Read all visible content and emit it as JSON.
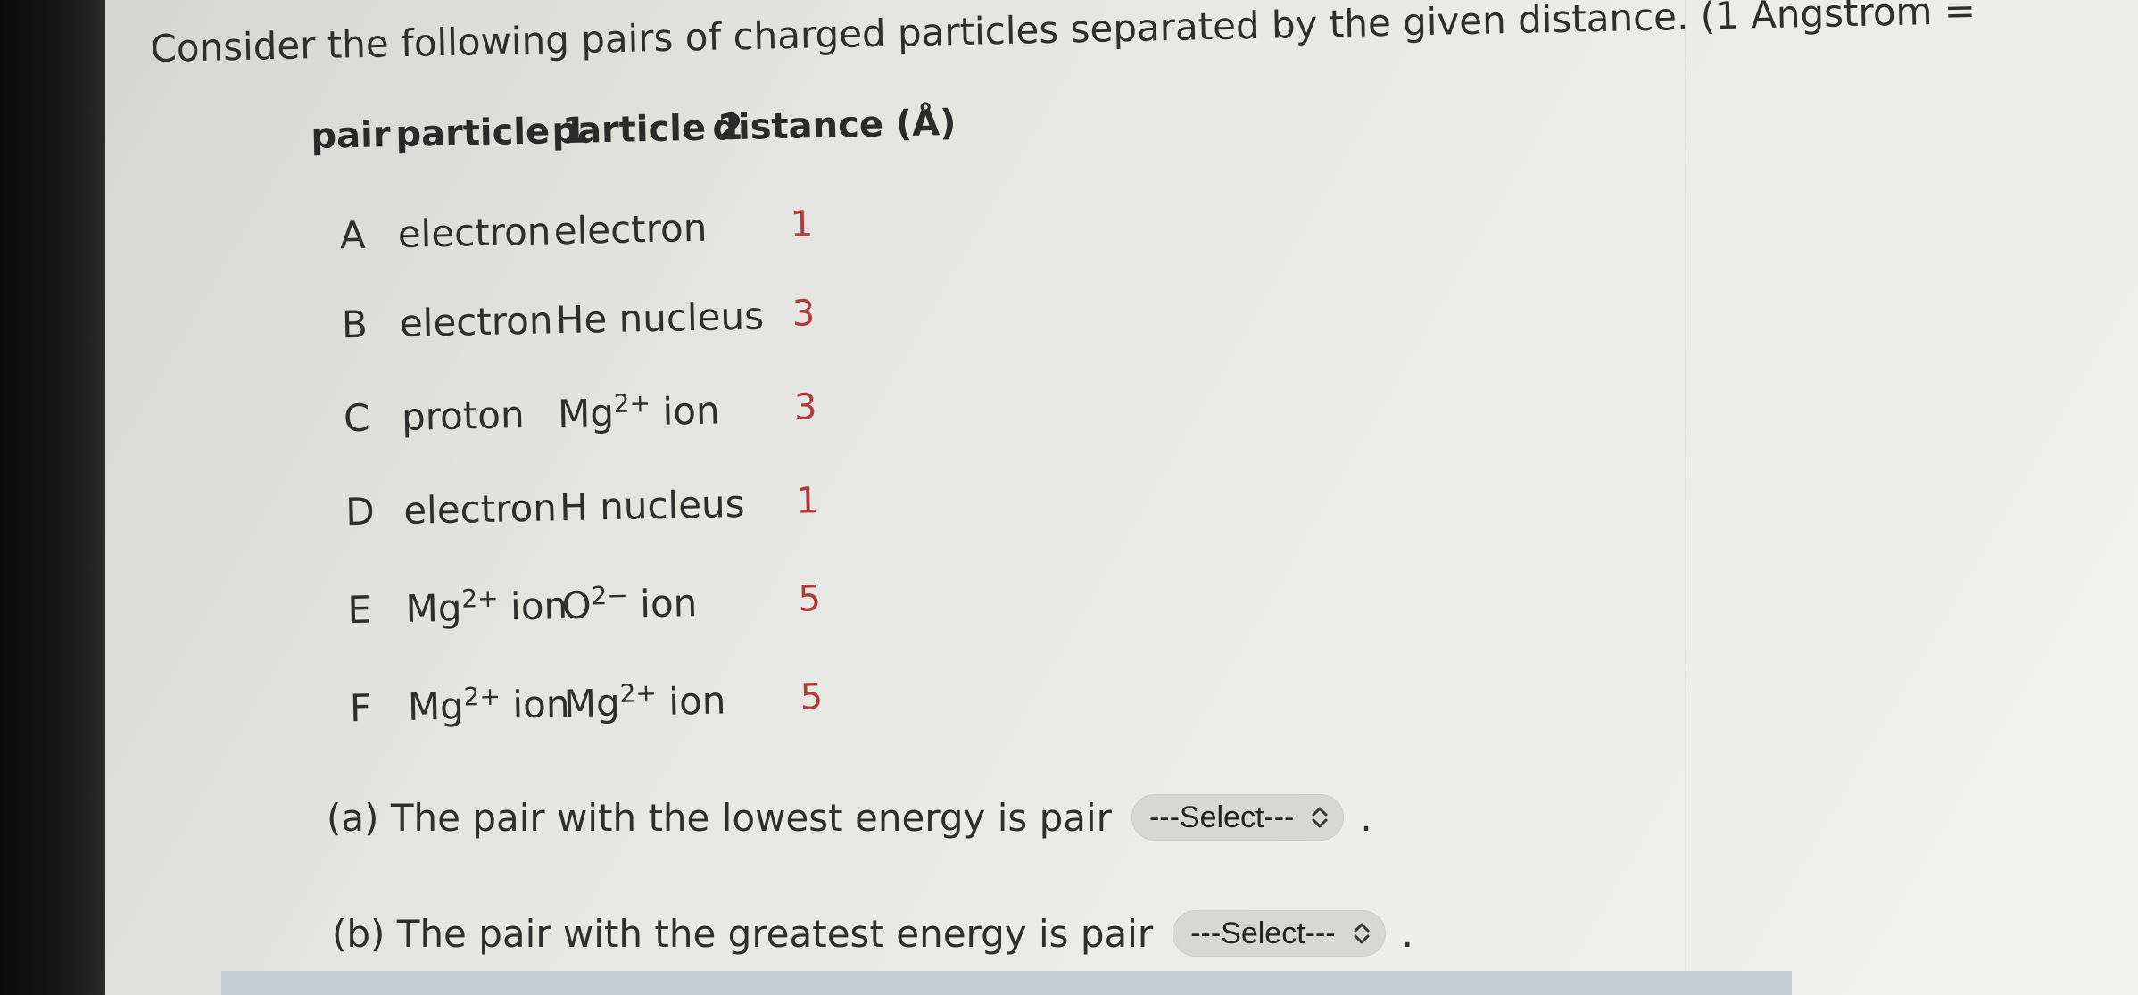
{
  "question": {
    "text": "Consider the following pairs of charged particles separated by the given distance. (1 Angstrom ="
  },
  "table": {
    "headers": {
      "pair": "pair",
      "particle1": "particle 1",
      "particle2": "particle 2",
      "distance": "distance (Å)"
    },
    "rows": [
      {
        "pair": "A",
        "p1": "electron",
        "p1_sup": "",
        "p1_suffix": "",
        "p2": "electron",
        "p2_sup": "",
        "p2_suffix": "",
        "distance": "1"
      },
      {
        "pair": "B",
        "p1": "electron",
        "p1_sup": "",
        "p1_suffix": "",
        "p2": "He nucleus",
        "p2_sup": "",
        "p2_suffix": "",
        "distance": "3"
      },
      {
        "pair": "C",
        "p1": "proton",
        "p1_sup": "",
        "p1_suffix": "",
        "p2": "Mg",
        "p2_sup": "2+",
        "p2_suffix": " ion",
        "distance": "3"
      },
      {
        "pair": "D",
        "p1": "electron",
        "p1_sup": "",
        "p1_suffix": "",
        "p2": "H nucleus",
        "p2_sup": "",
        "p2_suffix": "",
        "distance": "1"
      },
      {
        "pair": "E",
        "p1": "Mg",
        "p1_sup": "2+",
        "p1_suffix": " ion",
        "p2": "O",
        "p2_sup": "2−",
        "p2_suffix": " ion",
        "distance": "5"
      },
      {
        "pair": "F",
        "p1": "Mg",
        "p1_sup": "2+",
        "p1_suffix": " ion",
        "p2": "Mg",
        "p2_sup": "2+",
        "p2_suffix": " ion",
        "distance": "5"
      }
    ]
  },
  "answers": {
    "a": {
      "label": "(a) The pair with the lowest energy is pair",
      "select": "---Select---",
      "end": "."
    },
    "b": {
      "label": "(b) The pair with the greatest energy is pair",
      "select": "---Select---",
      "end": "."
    }
  },
  "icons": {
    "select_chevron": "chevron-up-down-icon"
  },
  "colors": {
    "distance_value": "#b33a3a",
    "select_bg": "#d7d7d3",
    "bottom_bar": "#c4ccd4"
  }
}
